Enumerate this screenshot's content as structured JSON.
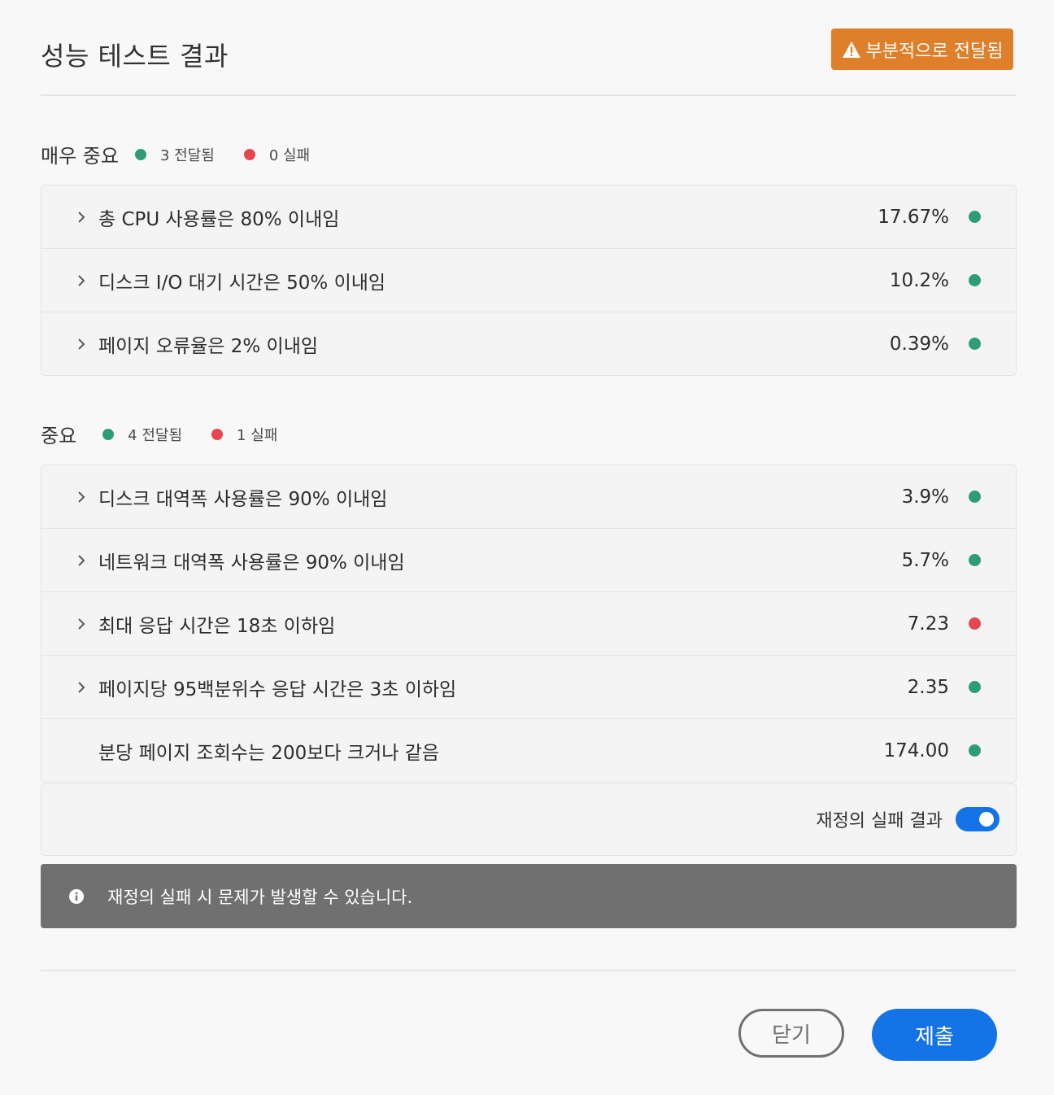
{
  "dialog": {
    "title": "성능 테스트 결과",
    "status_badge": "부분적으로 전달됨",
    "colors": {
      "accent": "#1473e6",
      "warning": "#e07f2a",
      "pass": "#2d9d78",
      "fail": "#e34850"
    }
  },
  "sections": [
    {
      "title": "매우 중요",
      "passed_label": "3 전달됨",
      "failed_label": "0 실패",
      "rows": [
        {
          "label": "총 CPU 사용률은 80% 이내임",
          "value": "17.67%",
          "status": "pass",
          "expandable": true
        },
        {
          "label": "디스크 I/O 대기 시간은 50% 이내임",
          "value": "10.2%",
          "status": "pass",
          "expandable": true
        },
        {
          "label": "페이지 오류율은 2% 이내임",
          "value": "0.39%",
          "status": "pass",
          "expandable": true
        }
      ]
    },
    {
      "title": "중요",
      "passed_label": "4 전달됨",
      "failed_label": "1 실패",
      "rows": [
        {
          "label": "디스크 대역폭 사용률은 90% 이내임",
          "value": "3.9%",
          "status": "pass",
          "expandable": true
        },
        {
          "label": "네트워크 대역폭 사용률은 90% 이내임",
          "value": "5.7%",
          "status": "pass",
          "expandable": true
        },
        {
          "label": "최대 응답 시간은 18초 이하임",
          "value": "7.23",
          "status": "fail",
          "expandable": true
        },
        {
          "label": "페이지당 95백분위수 응답 시간은 3초 이하임",
          "value": "2.35",
          "status": "pass",
          "expandable": true
        },
        {
          "label": "분당 페이지 조회수는 200보다 크거나 같음",
          "value": "174.00",
          "status": "pass",
          "expandable": false
        }
      ]
    }
  ],
  "override": {
    "label": "재정의 실패 결과",
    "enabled": true
  },
  "info": {
    "icon": "info-icon",
    "text": "재정의 실패 시 문제가 발생할 수 있습니다."
  },
  "footer": {
    "close_label": "닫기",
    "submit_label": "제출"
  }
}
